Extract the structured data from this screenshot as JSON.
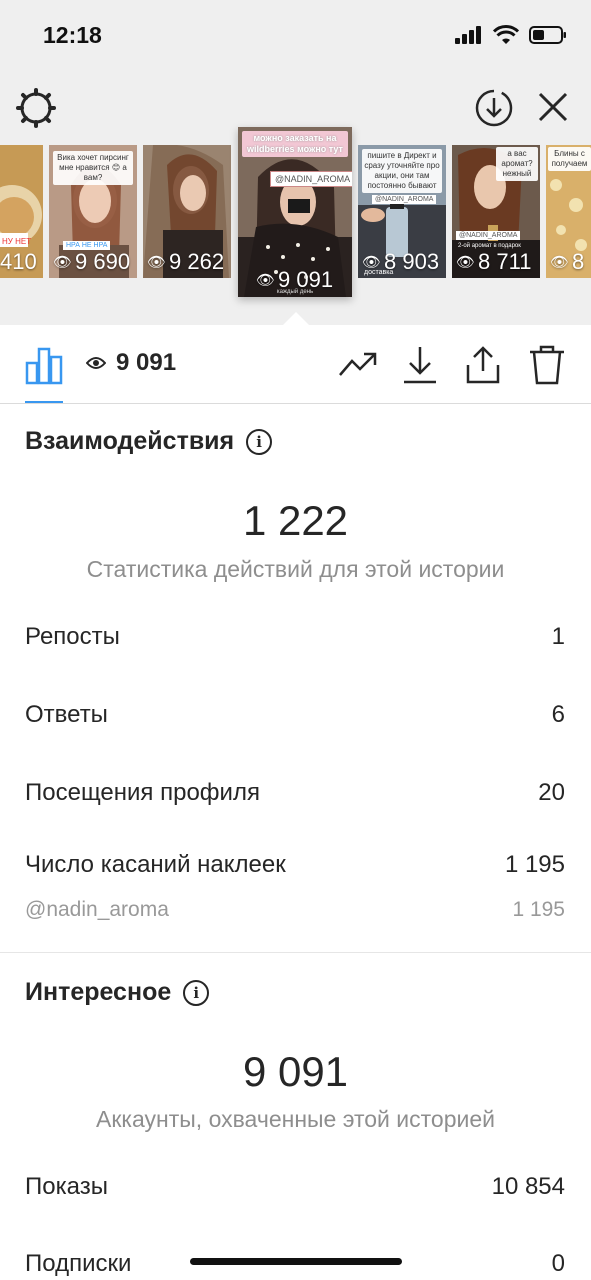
{
  "status_bar": {
    "time": "12:18"
  },
  "stories": [
    {
      "views": "410",
      "caption": "",
      "top_tag": "",
      "bottom_tag": "НУ НЕТ",
      "bg": "#c69a55"
    },
    {
      "views": "9 690",
      "caption": "Вика хочет пирсинг мне нравится 😊 а вам?",
      "top_tag": "",
      "bottom_tag": "НРА   НЕ НРА",
      "bg": "#b99a86"
    },
    {
      "views": "9 262",
      "caption": "",
      "top_tag": "",
      "bottom_tag": "",
      "bg": "#9a8470"
    },
    {
      "views": "9 091",
      "caption": "можно заказать на wildberries можно тут",
      "top_tag": "@NADIN_AROMA",
      "bottom_tag": "каждый день",
      "bg": "#7d6a5c"
    },
    {
      "views": "8 903",
      "caption": "пишите в Директ и сразу уточняйте про акции, они там постоянно бывают",
      "top_tag": "@NADIN_AROMA",
      "bottom_tag": "доставка",
      "bg": "#8b9aa8"
    },
    {
      "views": "8 711",
      "caption": "а вас аромат? нежный",
      "top_tag": "@NADIN_AROMA",
      "bottom_tag": "2-ой аромат в подарок",
      "bg": "#6c5a4c"
    },
    {
      "views": "8",
      "caption": "Блины с получаем",
      "top_tag": "",
      "bottom_tag": "",
      "bg": "#d9b06a"
    }
  ],
  "toolbar": {
    "views": "9 091"
  },
  "interactions": {
    "title": "Взаимодействия",
    "total": "1 222",
    "subtitle": "Статистика действий для этой истории",
    "rows": [
      {
        "label": "Репосты",
        "value": "1"
      },
      {
        "label": "Ответы",
        "value": "6"
      },
      {
        "label": "Посещения профиля",
        "value": "20"
      },
      {
        "label": "Число касаний наклеек",
        "value": "1 195"
      }
    ],
    "sticker": {
      "label": "@nadin_aroma",
      "value": "1 195"
    }
  },
  "discovery": {
    "title": "Интересное",
    "total": "9 091",
    "subtitle": "Аккаунты, охваченные этой историей",
    "rows": [
      {
        "label": "Показы",
        "value": "10 854"
      },
      {
        "label": "Подписки",
        "value": "0"
      }
    ]
  },
  "colors": {
    "accent": "#3897f0",
    "text": "#262626",
    "muted": "#8e8e8e"
  }
}
